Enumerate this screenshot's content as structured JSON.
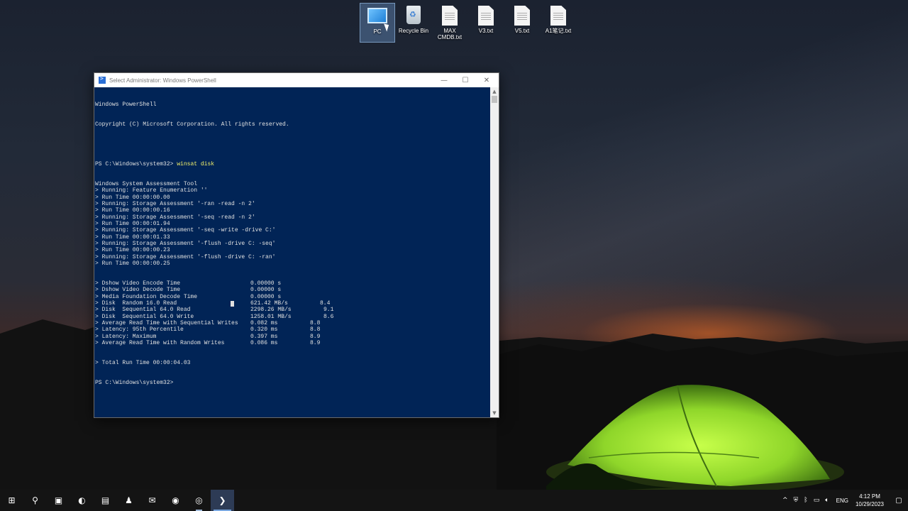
{
  "desktop": {
    "icons": [
      {
        "label": "PC",
        "type": "pc-icon",
        "selected": true
      },
      {
        "label": "Recycle Bin",
        "type": "recycle-bin-icon"
      },
      {
        "label": "MAX CMDB.txt",
        "type": "text-file-icon"
      },
      {
        "label": "V3.txt",
        "type": "text-file-icon"
      },
      {
        "label": "V5.txt",
        "type": "text-file-icon"
      },
      {
        "label": "A1笔记.txt",
        "type": "text-file-icon"
      }
    ]
  },
  "window": {
    "title": "Select Administrator: Windows PowerShell",
    "minimize_glyph": "—",
    "maximize_glyph": "☐",
    "close_glyph": "✕",
    "background": "#012456"
  },
  "console": {
    "header": [
      "Windows PowerShell",
      "Copyright (C) Microsoft Corporation. All rights reserved."
    ],
    "prompt": "PS C:\\Windows\\system32>",
    "command": "winsat disk",
    "lines": [
      "Windows System Assessment Tool",
      "> Running: Feature Enumeration ''",
      "> Run Time 00:00:00.00",
      "> Running: Storage Assessment '-ran -read -n 2'",
      "> Run Time 00:00:00.16",
      "> Running: Storage Assessment '-seq -read -n 2'",
      "> Run Time 00:00:01.94",
      "> Running: Storage Assessment '-seq -write -drive C:'",
      "> Run Time 00:00:01.33",
      "> Running: Storage Assessment '-flush -drive C: -seq'",
      "> Run Time 00:00:00.23",
      "> Running: Storage Assessment '-flush -drive C: -ran'",
      "> Run Time 00:00:00.25"
    ],
    "results": [
      {
        "label": "> Dshow Video Encode Time",
        "value": "0.00000 s",
        "score": ""
      },
      {
        "label": "> Dshow Video Decode Time",
        "value": "0.00000 s",
        "score": ""
      },
      {
        "label": "> Media Foundation Decode Time",
        "value": "0.00000 s",
        "score": ""
      },
      {
        "label": "> Disk  Random 16.0 Read",
        "value": "621.42 MB/s",
        "score": "8.4"
      },
      {
        "label": "> Disk  Sequential 64.0 Read",
        "value": "2298.26 MB/s",
        "score": "9.1"
      },
      {
        "label": "> Disk  Sequential 64.0 Write",
        "value": "1258.01 MB/s",
        "score": "8.6"
      },
      {
        "label": "> Average Read Time with Sequential Writes",
        "value": "0.082 ms",
        "score": "8.8"
      },
      {
        "label": "> Latency: 95th Percentile",
        "value": "0.320 ms",
        "score": "8.8"
      },
      {
        "label": "> Latency: Maximum",
        "value": "0.397 ms",
        "score": "8.9"
      },
      {
        "label": "> Average Read Time with Random Writes",
        "value": "0.086 ms",
        "score": "8.9"
      }
    ],
    "total": "> Total Run Time 00:00:04.03",
    "final_prompt": "PS C:\\Windows\\system32>"
  },
  "taskbar": {
    "apps": [
      {
        "name": "start-button",
        "glyph": "⊞"
      },
      {
        "name": "search-button",
        "glyph": "⚲"
      },
      {
        "name": "file-explorer-app",
        "glyph": "▣"
      },
      {
        "name": "edge-app",
        "glyph": "◐"
      },
      {
        "name": "store-app",
        "glyph": "▤"
      },
      {
        "name": "teams-app",
        "glyph": "♟"
      },
      {
        "name": "mail-app",
        "glyph": "✉"
      },
      {
        "name": "chrome-app",
        "glyph": "◉"
      },
      {
        "name": "obs-app",
        "glyph": "◎"
      },
      {
        "name": "powershell-app",
        "glyph": "❯"
      }
    ],
    "tray": {
      "chevron": "^",
      "language": "ENG",
      "time": "4:12 PM",
      "date": "10/29/2023"
    }
  }
}
